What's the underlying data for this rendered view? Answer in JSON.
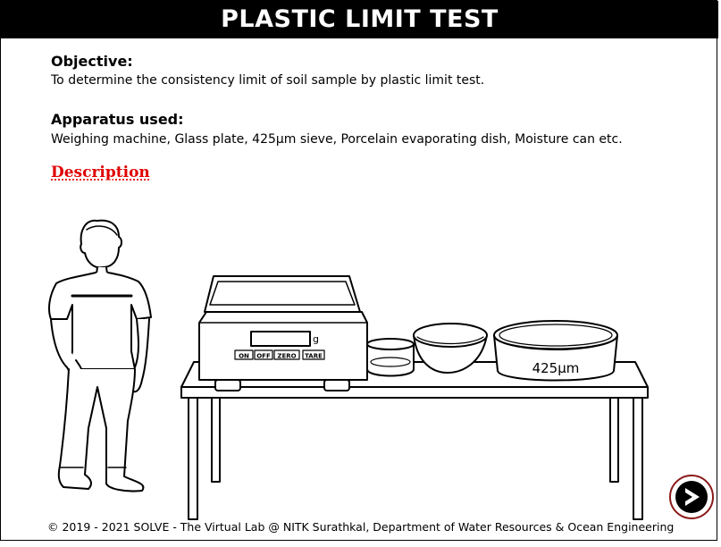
{
  "title": "PLASTIC LIMIT TEST",
  "objective": {
    "heading": "Objective:",
    "text": "To determine the consistency limit of soil sample by plastic limit test."
  },
  "apparatus": {
    "heading": "Apparatus used:",
    "text": "Weighing machine, Glass plate, 425μm sieve, Porcelain evaporating dish, Moisture can etc."
  },
  "description_link": "Description",
  "scale": {
    "unit": "g",
    "buttons": [
      "ON",
      "OFF",
      "ZERO",
      "TARE"
    ]
  },
  "sieve_label": "425μm",
  "footer": "© 2019 - 2021 SOLVE - The Virtual Lab @ NITK Surathkal, Department of Water Resources & Ocean Engineering",
  "icons": {
    "next": "next-arrow-icon"
  }
}
